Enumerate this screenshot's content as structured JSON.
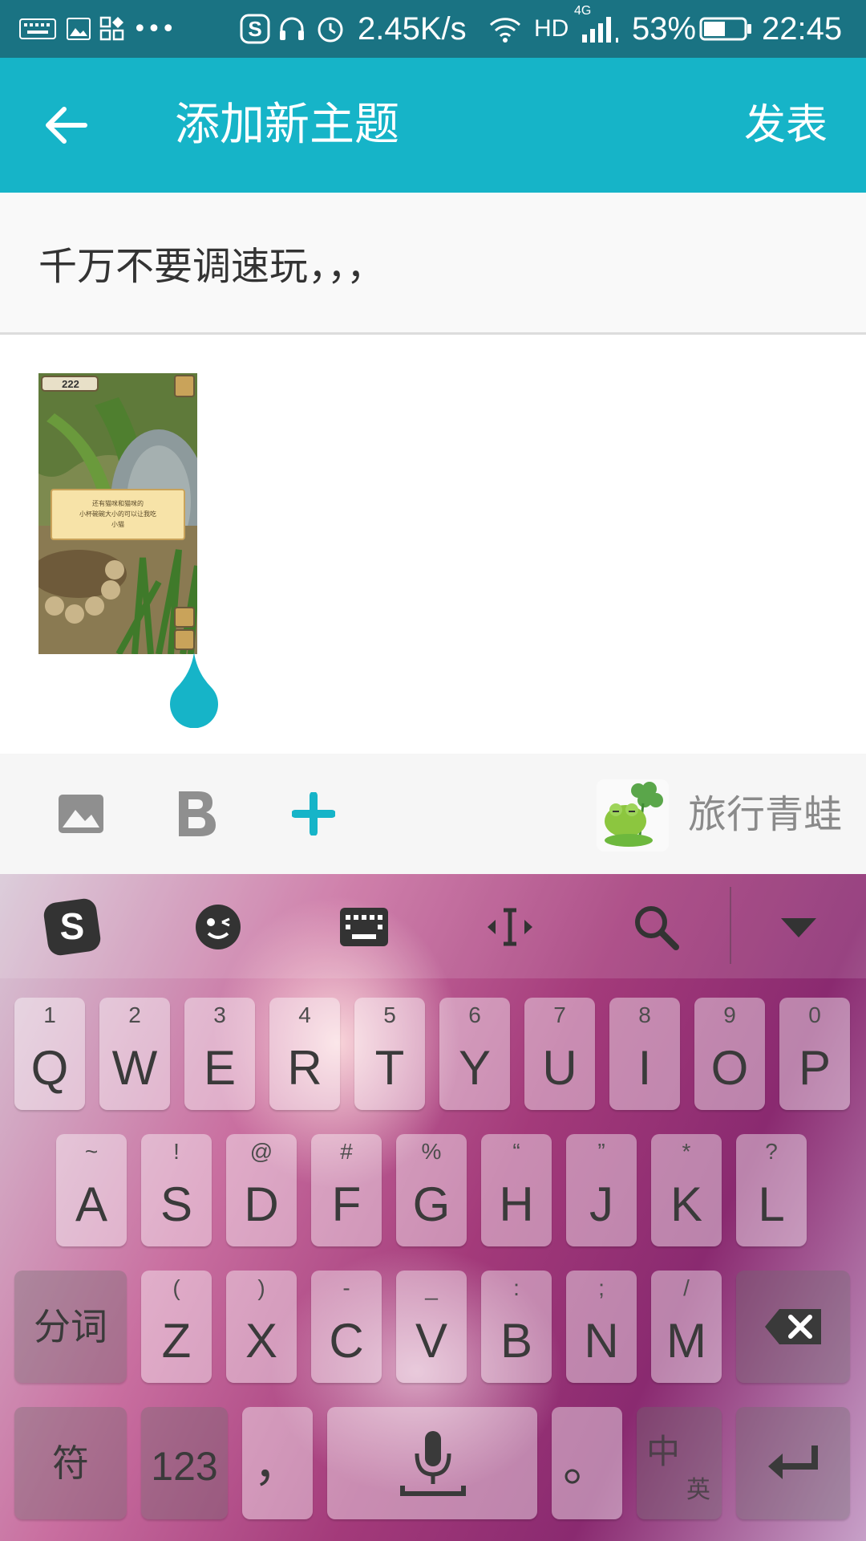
{
  "status_bar": {
    "speed": "2.45K/s",
    "network": "HD",
    "network_gen": "4G",
    "battery": "53%",
    "time": "22:45",
    "icons": [
      "keyboard-icon",
      "image-icon",
      "apps-icon",
      "more-icon",
      "sogou-icon",
      "headset-icon",
      "alarm-icon",
      "wifi-icon",
      "signal-icon",
      "battery-icon"
    ]
  },
  "app_bar": {
    "title": "添加新主题",
    "publish_label": "发表",
    "back_icon": "arrow-left-icon"
  },
  "post": {
    "title_value": "千万不要调速玩，，，",
    "attachment": {
      "counter": "222",
      "dialog_line1": "还有猫咪和猫咪的",
      "dialog_line2": "小杯碗碗大小的可以让我吃",
      "dialog_line3": "小猫"
    }
  },
  "toolbar": {
    "image_icon": "image-icon",
    "bold_icon": "bold-icon",
    "add_icon": "plus-icon",
    "board_name": "旅行青蛙",
    "accent": "#16b4c8"
  },
  "keyboard": {
    "tools": [
      "sogou-logo-icon",
      "emoji-icon",
      "keyboard-icon",
      "cursor-icon",
      "search-icon",
      "collapse-icon"
    ],
    "row1": [
      {
        "main": "Q",
        "sub": "1"
      },
      {
        "main": "W",
        "sub": "2"
      },
      {
        "main": "E",
        "sub": "3"
      },
      {
        "main": "R",
        "sub": "4"
      },
      {
        "main": "T",
        "sub": "5"
      },
      {
        "main": "Y",
        "sub": "6"
      },
      {
        "main": "U",
        "sub": "7"
      },
      {
        "main": "I",
        "sub": "8"
      },
      {
        "main": "O",
        "sub": "9"
      },
      {
        "main": "P",
        "sub": "0"
      }
    ],
    "row2": [
      {
        "main": "A",
        "sub": "~"
      },
      {
        "main": "S",
        "sub": "!"
      },
      {
        "main": "D",
        "sub": "@"
      },
      {
        "main": "F",
        "sub": "#"
      },
      {
        "main": "G",
        "sub": "%"
      },
      {
        "main": "H",
        "sub": "“"
      },
      {
        "main": "J",
        "sub": "”"
      },
      {
        "main": "K",
        "sub": "*"
      },
      {
        "main": "L",
        "sub": "?"
      }
    ],
    "row3": [
      {
        "main": "Z",
        "sub": "("
      },
      {
        "main": "X",
        "sub": ")"
      },
      {
        "main": "C",
        "sub": "-"
      },
      {
        "main": "V",
        "sub": "_"
      },
      {
        "main": "B",
        "sub": ":"
      },
      {
        "main": "N",
        "sub": ";"
      },
      {
        "main": "M",
        "sub": "/"
      }
    ],
    "segment_label": "分词",
    "symbol_label": "符",
    "num_label": "123",
    "comma_label": "，",
    "period_label": "。",
    "lang_main": "中",
    "lang_sub": "英"
  }
}
